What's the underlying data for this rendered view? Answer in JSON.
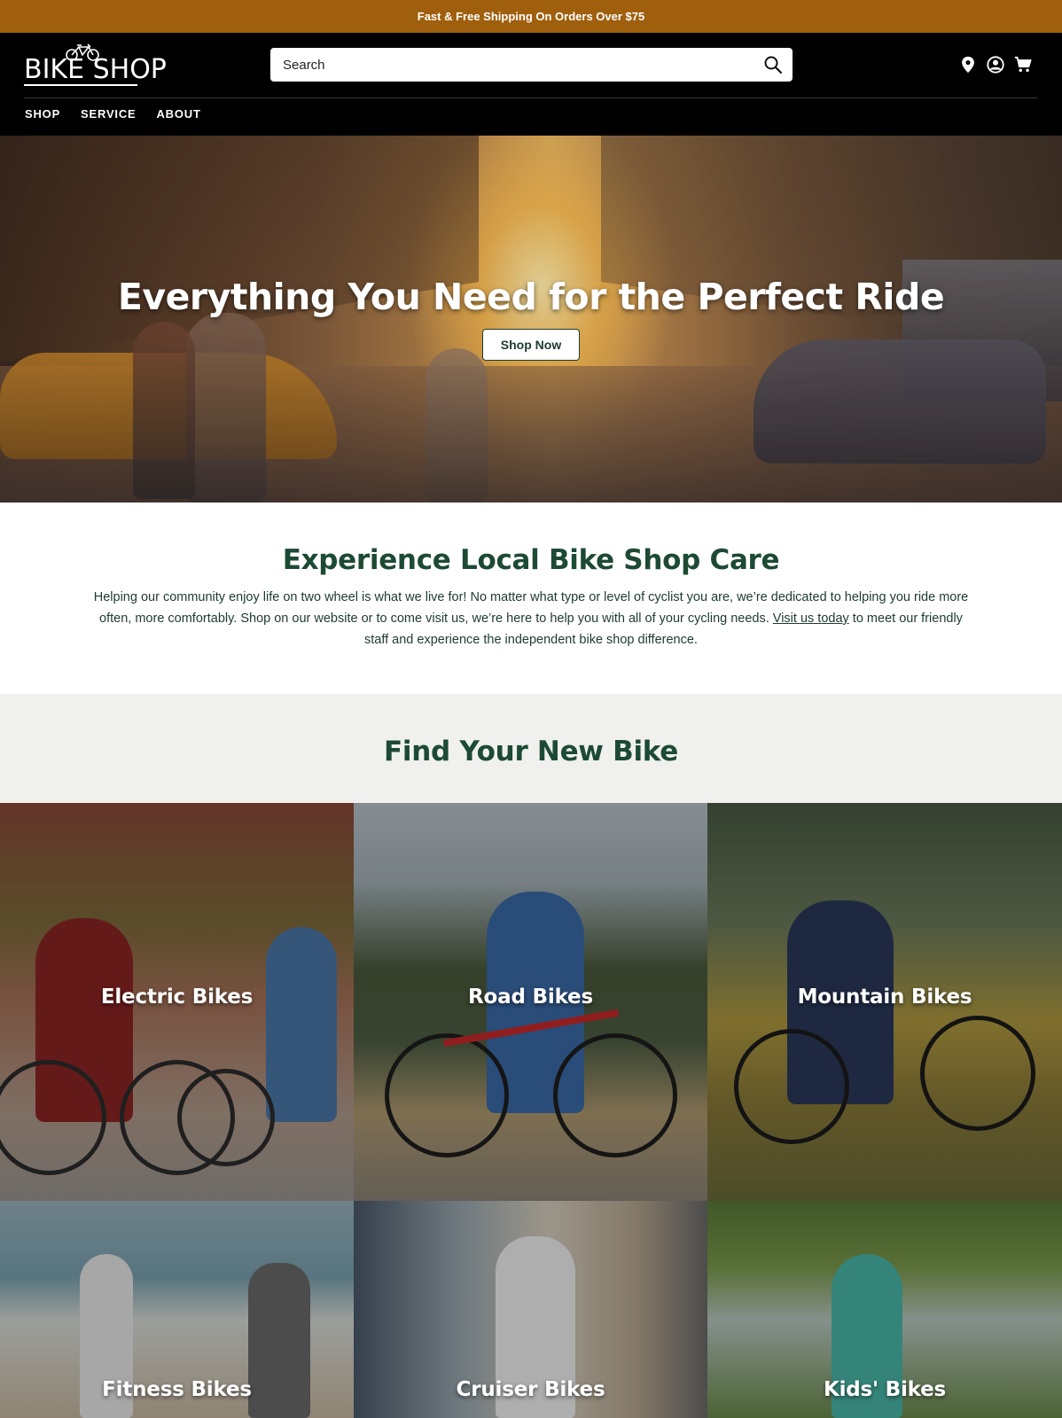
{
  "promo": {
    "text": "Fast & Free Shipping On Orders Over $75"
  },
  "header": {
    "logo_text": "BIKE SHOP",
    "search": {
      "placeholder": "Search",
      "value": ""
    },
    "icons": [
      "location-pin-icon",
      "account-icon",
      "cart-icon"
    ]
  },
  "nav": {
    "items": [
      "SHOP",
      "SERVICE",
      "ABOUT"
    ]
  },
  "hero": {
    "title": "Everything You Need for the Perfect Ride",
    "button": "Shop Now"
  },
  "care": {
    "title": "Experience Local Bike Shop Care",
    "text_before": "Helping our community enjoy life on two wheel is what we live for! No matter what type or level of cyclist you are, we’re dedicated to helping you ride more often, more comfortably. Shop on our website or to come visit us, we’re here to help you with all of your cycling needs. ",
    "link": "Visit us today",
    "text_after": " to meet our friendly staff and experience the independent bike shop difference."
  },
  "find": {
    "title": "Find Your New Bike",
    "categories": [
      "Electric Bikes",
      "Road Bikes",
      "Mountain Bikes",
      "Fitness Bikes",
      "Cruiser Bikes",
      "Kids' Bikes"
    ]
  },
  "colors": {
    "promo_bar": "#a05f0c",
    "header_bg": "#000000",
    "heading_green": "#1d4a34",
    "section_gray": "#f0f1ef"
  }
}
